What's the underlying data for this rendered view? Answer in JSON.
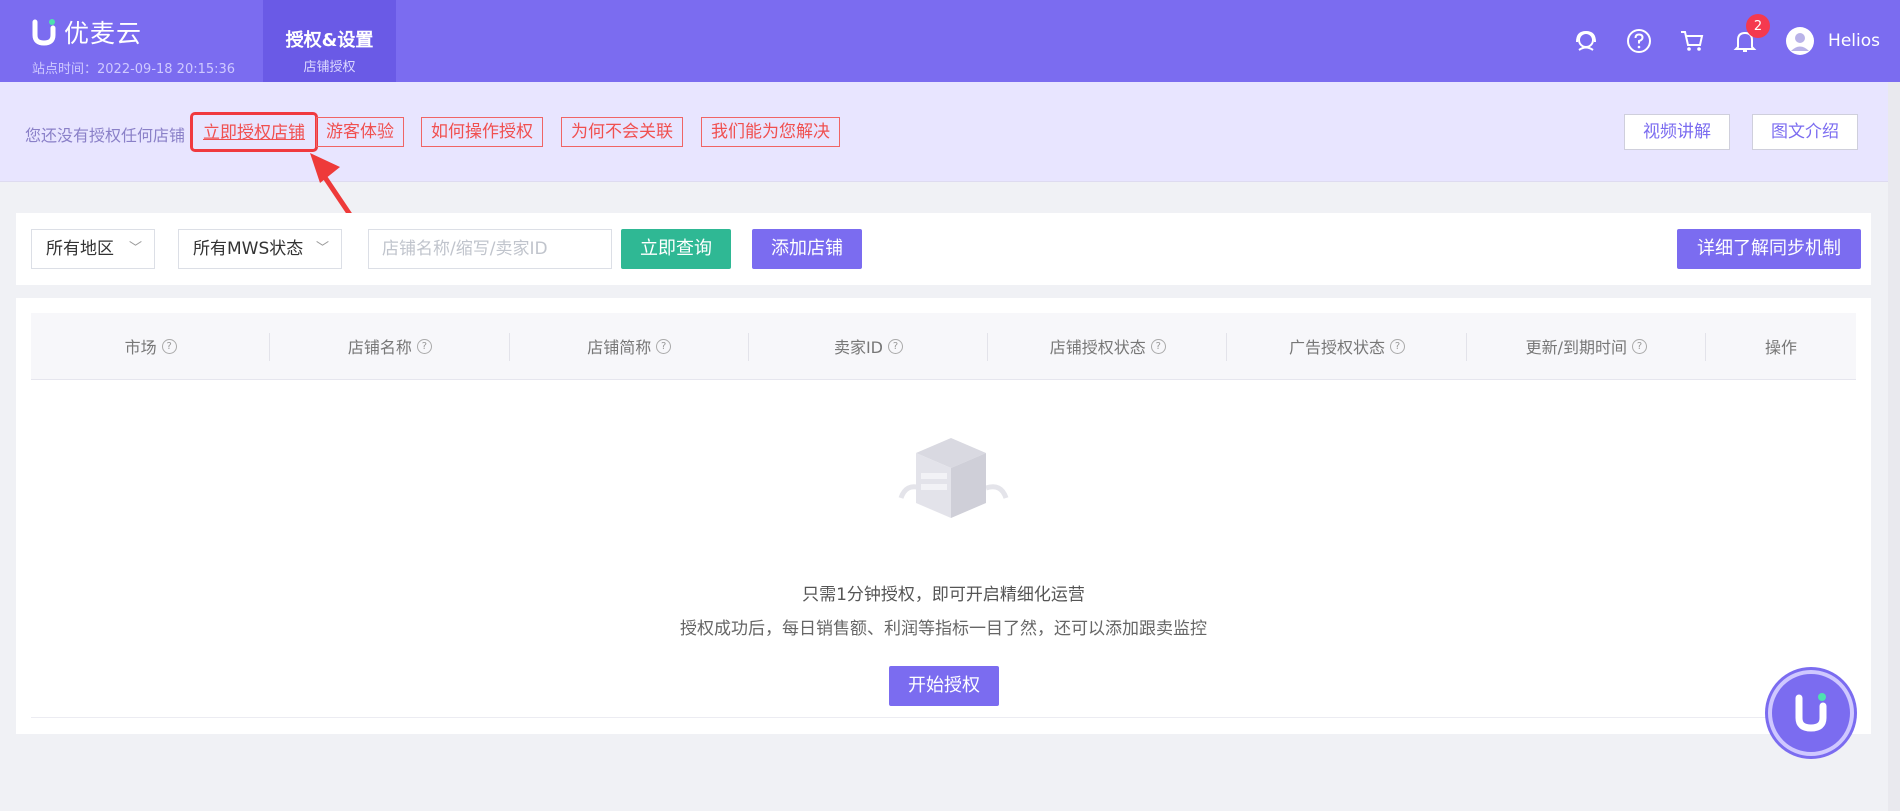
{
  "header": {
    "brand_name": "优麦云",
    "site_time": "站点时间：2022-09-18 20:15:36",
    "active_tab_title": "授权&设置",
    "active_tab_sub": "店铺授权",
    "notification_count": "2",
    "username": "Helios",
    "icons": [
      "headset-icon",
      "help-icon",
      "cart-icon",
      "bell-icon",
      "avatar-icon"
    ]
  },
  "notice": {
    "text": "您还没有授权任何店铺",
    "links": [
      "立即授权店铺",
      "游客体验",
      "如何操作授权",
      "为何不会关联",
      "我们能为您解决"
    ],
    "video_button": "视频讲解",
    "article_button": "图文介绍"
  },
  "filter": {
    "region_select": "所有地区",
    "mws_select": "所有MWS状态",
    "search_placeholder": "店铺名称/缩写/卖家ID",
    "query_button": "立即查询",
    "add_store_button": "添加店铺",
    "sync_button": "详细了解同步机制"
  },
  "table": {
    "columns": [
      "市场",
      "店铺名称",
      "店铺简称",
      "卖家ID",
      "店铺授权状态",
      "广告授权状态",
      "更新/到期时间",
      "操作"
    ],
    "rows": []
  },
  "empty_state": {
    "line1": "只需1分钟授权，即可开启精细化运营",
    "line2": "授权成功后，每日销售额、利润等指标一目了然，还可以添加跟卖监控",
    "start_button": "开始授权"
  },
  "colors": {
    "brand": "#7b6cf0",
    "accent_green": "#2fb894",
    "alert_red": "#f0393f"
  }
}
